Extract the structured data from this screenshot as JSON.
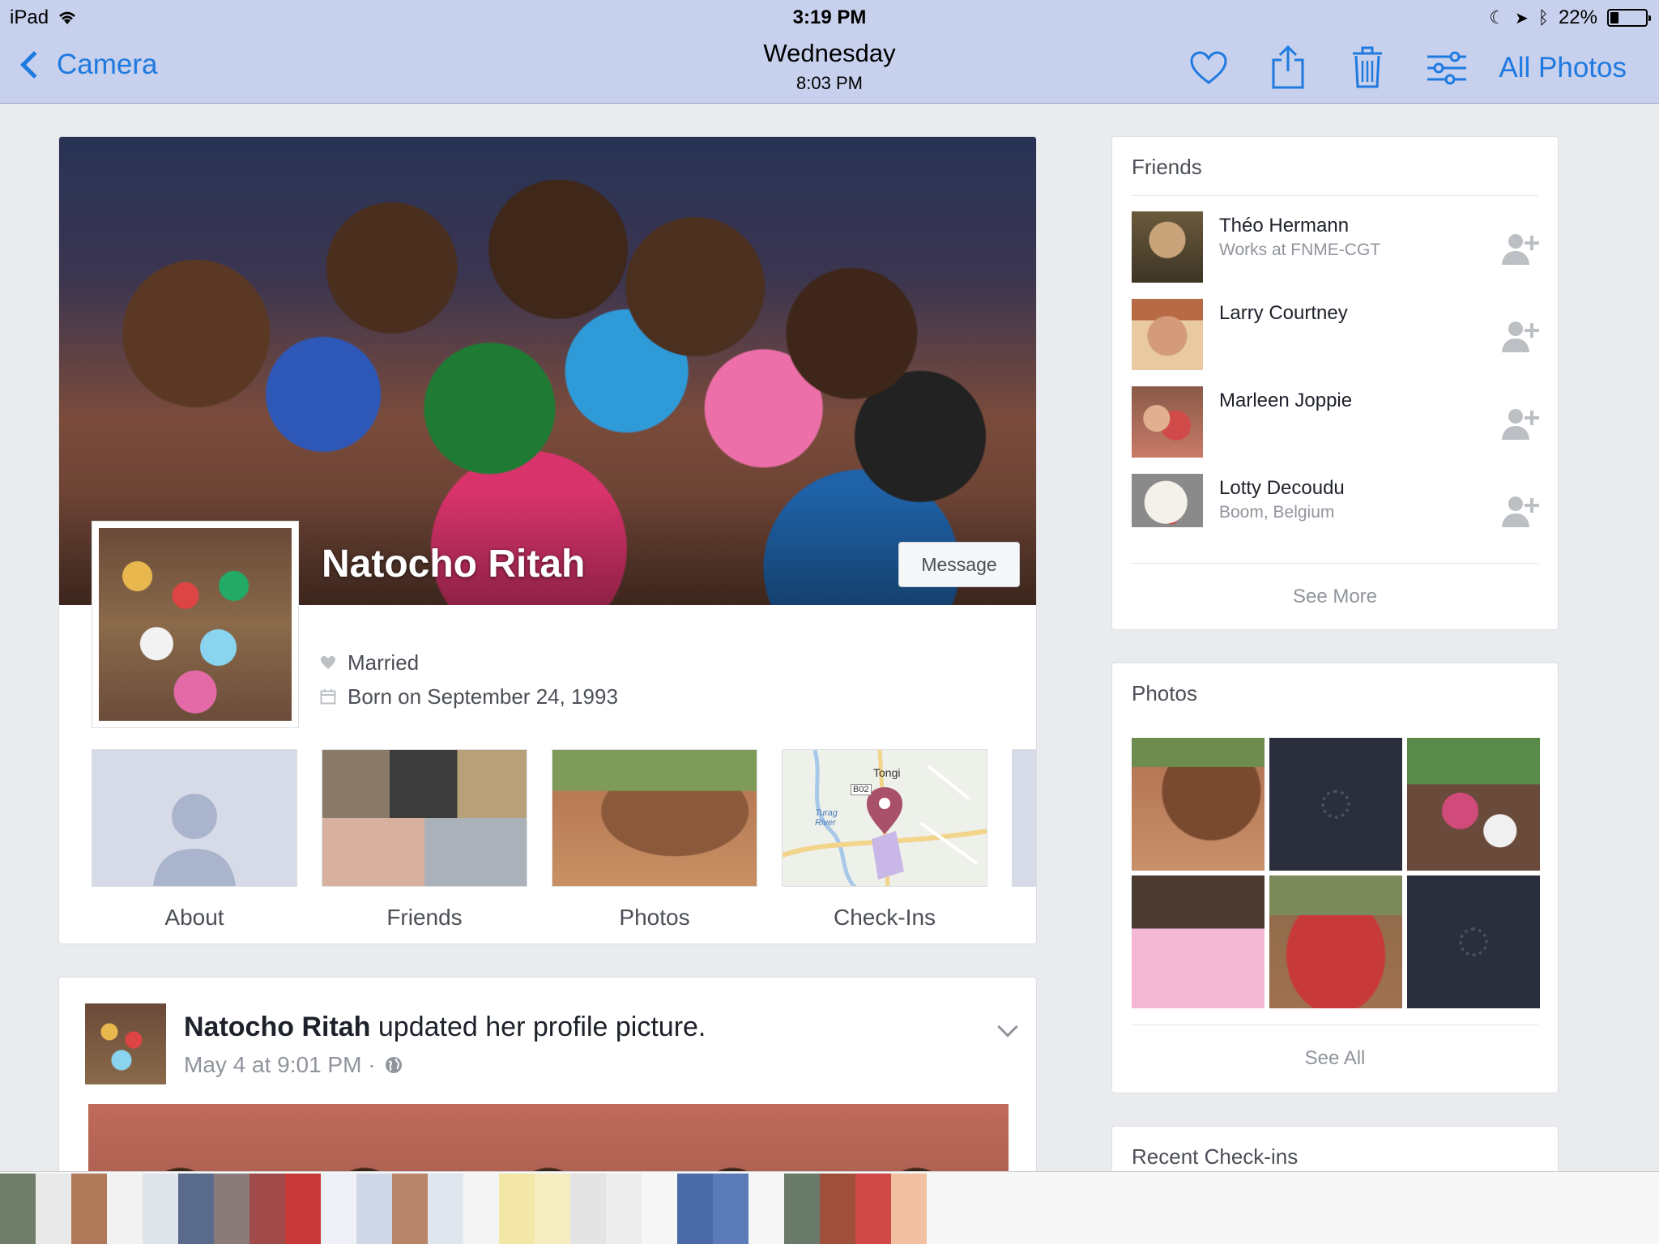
{
  "status_bar": {
    "device": "iPad",
    "time": "3:19 PM",
    "battery": "22%",
    "battery_level": 0.22
  },
  "nav": {
    "back_label": "Camera",
    "title_day": "Wednesday",
    "title_time": "8:03 PM",
    "all_photos_label": "All Photos"
  },
  "profile": {
    "name": "Natocho Ritah",
    "message_label": "Message",
    "relationship": "Married",
    "birthday": "Born on September 24, 1993",
    "tiles": [
      {
        "label": "About"
      },
      {
        "label": "Friends"
      },
      {
        "label": "Photos"
      },
      {
        "label": "Check-Ins"
      }
    ],
    "map": {
      "place": "Tongi",
      "road": "B02",
      "river": "Turag River"
    }
  },
  "post": {
    "author": "Natocho Ritah",
    "action": " updated her profile picture.",
    "meta": "May 4 at 9:01 PM ·"
  },
  "friends_card": {
    "title": "Friends",
    "items": [
      {
        "name": "Théo Hermann",
        "sub": "Works at FNME-CGT"
      },
      {
        "name": "Larry Courtney",
        "sub": ""
      },
      {
        "name": "Marleen Joppie",
        "sub": ""
      },
      {
        "name": "Lotty Decoudu",
        "sub": "Boom, Belgium"
      }
    ],
    "see_more_label": "See More"
  },
  "photos_card": {
    "title": "Photos",
    "see_all_label": "See All"
  },
  "checkins_card": {
    "title": "Recent Check-ins"
  },
  "icons": {
    "back": "chevron-left-icon",
    "favorite": "heart-icon",
    "share": "share-icon",
    "delete": "trash-icon",
    "adjust": "sliders-icon",
    "add_friend": "add-friend-icon",
    "globe": "globe-icon",
    "heart_small": "heart-icon",
    "calendar": "calendar-icon"
  },
  "colors": {
    "accent": "#1f7ae0",
    "topbar": "#c7d0ec",
    "page_bg": "#e9ebee",
    "muted_text": "#90949c"
  }
}
